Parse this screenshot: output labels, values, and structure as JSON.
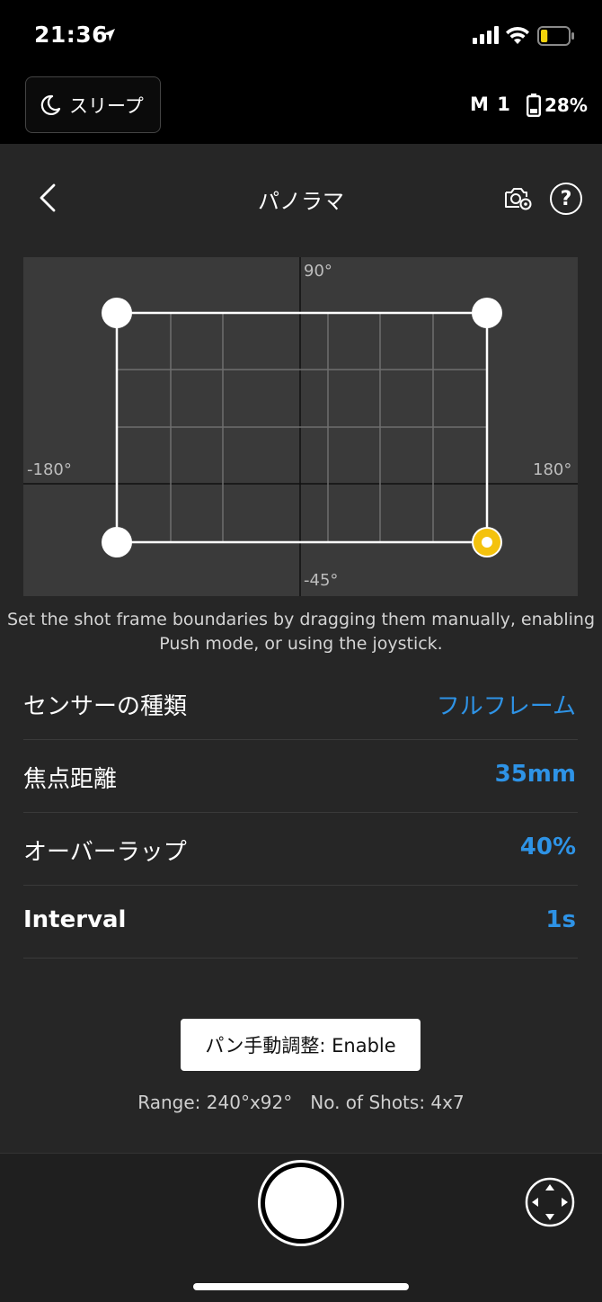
{
  "status_bar": {
    "time": "21:36",
    "battery_level": 0.25,
    "battery_color": "#f2d20b"
  },
  "header": {
    "sleep_label": "スリープ",
    "mode": "M 1",
    "gimbal_battery": "28%",
    "title": "パノラマ",
    "help_label": "?"
  },
  "pano": {
    "top_label": "90°",
    "bottom_label": "-45°",
    "left_label": "-180°",
    "right_label": "180°",
    "frame_color": "#ffffff",
    "active_handle_color": "#f4c20d"
  },
  "hint": "Set the shot frame boundaries by dragging them manually, enabling Push mode, or using the joystick.",
  "settings": [
    {
      "label": "センサーの種類",
      "value": "フルフレーム"
    },
    {
      "label": "焦点距離",
      "value": "35mm"
    },
    {
      "label": "オーバーラップ",
      "value": "40%"
    },
    {
      "label": "Interval",
      "value": "1s"
    }
  ],
  "pan_button_label": "パン手動調整: Enable",
  "range": "Range: 240°x92°",
  "shots": "No. of Shots: 4x7",
  "accent_color": "#2e93e6"
}
